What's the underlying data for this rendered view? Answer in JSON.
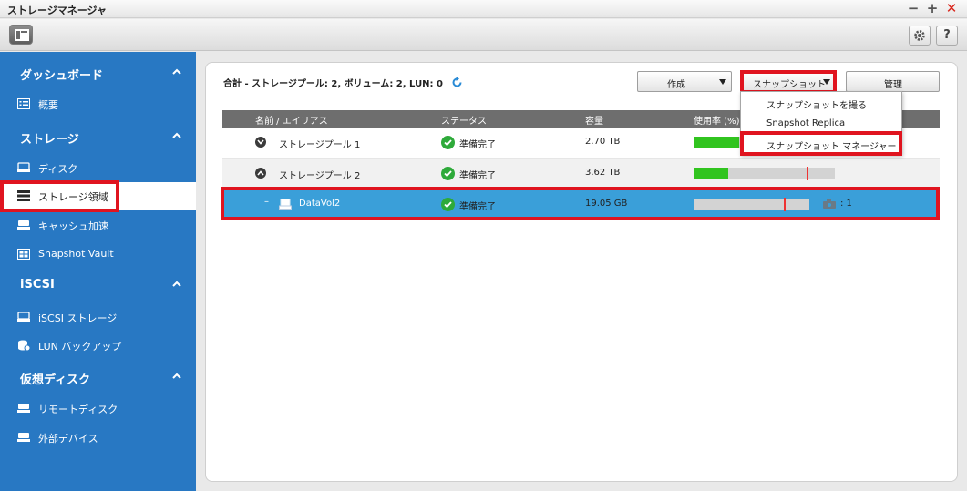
{
  "window": {
    "title": "ストレージマネージャ",
    "minimize": "−",
    "maximize": "+",
    "close": "✕"
  },
  "toolbar": {
    "panel_toggle_icon": "layout-icon",
    "gear_icon": "gear-icon",
    "help_label": "?"
  },
  "sidebar": {
    "sections": [
      {
        "label": "ダッシュボード",
        "items": [
          {
            "label": "概要",
            "icon": "overview-icon"
          }
        ]
      },
      {
        "label": "ストレージ",
        "items": [
          {
            "label": "ディスク",
            "icon": "disk-icon"
          },
          {
            "label": "ストレージ領域",
            "icon": "storage-space-icon"
          },
          {
            "label": "キャッシュ加速",
            "icon": "cache-icon"
          },
          {
            "label": "Snapshot Vault",
            "icon": "vault-icon"
          }
        ]
      },
      {
        "label": "iSCSI",
        "items": [
          {
            "label": "iSCSI ストレージ",
            "icon": "iscsi-icon"
          },
          {
            "label": "LUN バックアップ",
            "icon": "lun-backup-icon"
          }
        ]
      },
      {
        "label": "仮想ディスク",
        "items": [
          {
            "label": "リモートディスク",
            "icon": "remote-disk-icon"
          },
          {
            "label": "外部デバイス",
            "icon": "external-device-icon"
          }
        ]
      }
    ],
    "active_item": "ストレージ領域"
  },
  "main": {
    "summary": "合計 - ストレージプール: 2, ボリューム: 2, LUN: 0",
    "buttons": {
      "create": "作成",
      "snapshot": "スナップショット",
      "manage": "管理"
    },
    "snapshot_menu": [
      "スナップショットを撮る",
      "Snapshot Replica",
      "スナップショット マネージャー"
    ],
    "table": {
      "columns": [
        "名前 / エイリアス",
        "ステータス",
        "容量",
        "使用率 (%)"
      ],
      "rows": [
        {
          "name": "ストレージプール 1",
          "status": "準備完了",
          "capacity": "2.70 TB",
          "usage_fill": 0.32,
          "threshold": 0.8,
          "expanded": false
        },
        {
          "name": "ストレージプール 2",
          "status": "準備完了",
          "capacity": "3.62 TB",
          "usage_fill": 0.24,
          "threshold": 0.8,
          "expanded": true
        },
        {
          "name": "DataVol2",
          "status": "準備完了",
          "capacity": "19.05 GB",
          "usage_fill": 0.0,
          "threshold": 0.78,
          "snapshot_count": ": 1",
          "selected": true
        }
      ]
    }
  },
  "colors": {
    "sidebar": "#2878c3",
    "selected_row": "#3a9fd9",
    "highlight": "#e0141f",
    "usage_fill": "#31c41f",
    "status_ok": "#2eaa3a"
  }
}
